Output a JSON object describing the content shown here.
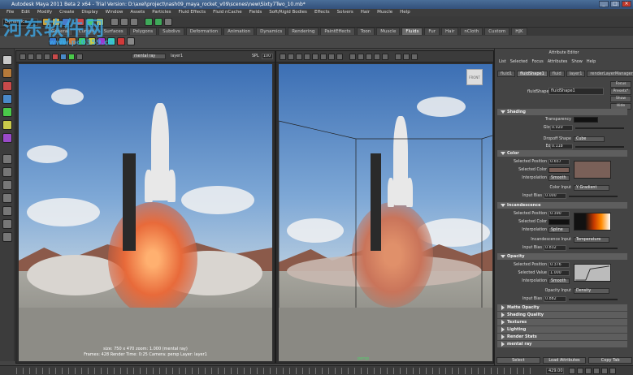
{
  "window": {
    "title": "Autodesk Maya 2011 Beta 2 x64 - Trial Version: D:\\axel\\project\\nash09_maya_rocket_v09\\scenes\\new\\Sixty7Two_10.mb*",
    "controls": [
      "_",
      "□",
      "×"
    ]
  },
  "menubar": [
    "File",
    "Edit",
    "Modify",
    "Create",
    "Display",
    "Window",
    "Assets",
    "Particles",
    "Fluid Effects",
    "Fluid nCache",
    "Fields",
    "Soft/Rigid Bodies",
    "Effects",
    "Solvers",
    "Hair",
    "Muscle",
    "Help"
  ],
  "mode_selector": "Dynamics",
  "shelf_tabs": [
    "General",
    "Curves",
    "Surfaces",
    "Polygons",
    "Subdivs",
    "Deformation",
    "Animation",
    "Dynamics",
    "Rendering",
    "PaintEffects",
    "Toon",
    "Muscle",
    "Fluids",
    "Fur",
    "Hair",
    "nCloth",
    "Custom",
    "HJK"
  ],
  "active_shelf_tab": "Fluids",
  "viewport_left": {
    "camera_menu": "mental ray",
    "layer": "layer1",
    "spl_label": "SPL",
    "spl_value": "100",
    "hud": {
      "line1": "size: 750 x 470 zoom: 1.000          (mental ray)",
      "line2": "Frames: 428      Render Time: 0:25      Camera: persp      Layer: layer1"
    }
  },
  "viewport_right": {
    "view_cube": "FRONT",
    "axis_label": "persp"
  },
  "attribute_editor": {
    "title": "Attribute Editor",
    "menu": [
      "List",
      "Selected",
      "Focus",
      "Attributes",
      "Show",
      "Help"
    ],
    "tabs": [
      "fluid1",
      "fluidShape1",
      "fluid",
      "layer1",
      "renderLayerManager",
      "time"
    ],
    "active_tab": "fluidShape1",
    "node_label": "fluidShape:",
    "node_value": "fluidShape1",
    "side_buttons": [
      "Focus",
      "Presets*",
      "Show",
      "Hide"
    ],
    "sections": {
      "shading": {
        "header": "Shading",
        "transparency_label": "Transparency",
        "glow_label": "Glow Intensity",
        "glow_value": "0.020",
        "dropoff_shape_label": "Dropoff Shape",
        "dropoff_shape_value": "Cube",
        "edge_dropoff_label": "Edge Dropoff",
        "edge_dropoff_value": "0.118"
      },
      "color": {
        "header": "Color",
        "selected_position_label": "Selected Position",
        "selected_position_value": "0.657",
        "selected_color_label": "Selected Color",
        "interpolation_label": "Interpolation",
        "interpolation_value": "Smooth",
        "color_input_label": "Color Input",
        "color_input_value": "Y Gradient",
        "input_bias_label": "Input Bias",
        "input_bias_value": "0.000"
      },
      "incandescence": {
        "header": "Incandescence",
        "selected_position_label": "Selected Position",
        "selected_position_value": "0.390",
        "selected_color_label": "Selected Color",
        "interpolation_label": "Interpolation",
        "interpolation_value": "Spline",
        "input_label": "Incandescence Input",
        "input_value": "Temperature",
        "input_bias_label": "Input Bias",
        "input_bias_value": "0.832"
      },
      "opacity": {
        "header": "Opacity",
        "selected_position_label": "Selected Position",
        "selected_position_value": "0.376",
        "selected_value_label": "Selected Value",
        "selected_value_value": "1.000",
        "interpolation_label": "Interpolation",
        "interpolation_value": "Smooth",
        "input_label": "Opacity Input",
        "input_value": "Density",
        "input_bias_label": "Input Bias",
        "input_bias_value": "0.882"
      }
    },
    "collapsed_sections": [
      "Matte Opacity",
      "Shading Quality",
      "Textures",
      "Lighting",
      "Render Stats",
      "mental ray"
    ],
    "footer_buttons": [
      "Select",
      "Load Attributes",
      "Copy Tab"
    ]
  },
  "timeline": {
    "current_frame": "429.00"
  },
  "watermark": {
    "text": "河东软件网",
    "url": "www.pc0359.cn"
  },
  "colors": {
    "ui_bg": "#444444",
    "title_blue": "#3e5f8c",
    "accent_orange": "#e86a3a",
    "color_swatch": "#7a6058",
    "incand_swatch": "#ff6a00"
  }
}
